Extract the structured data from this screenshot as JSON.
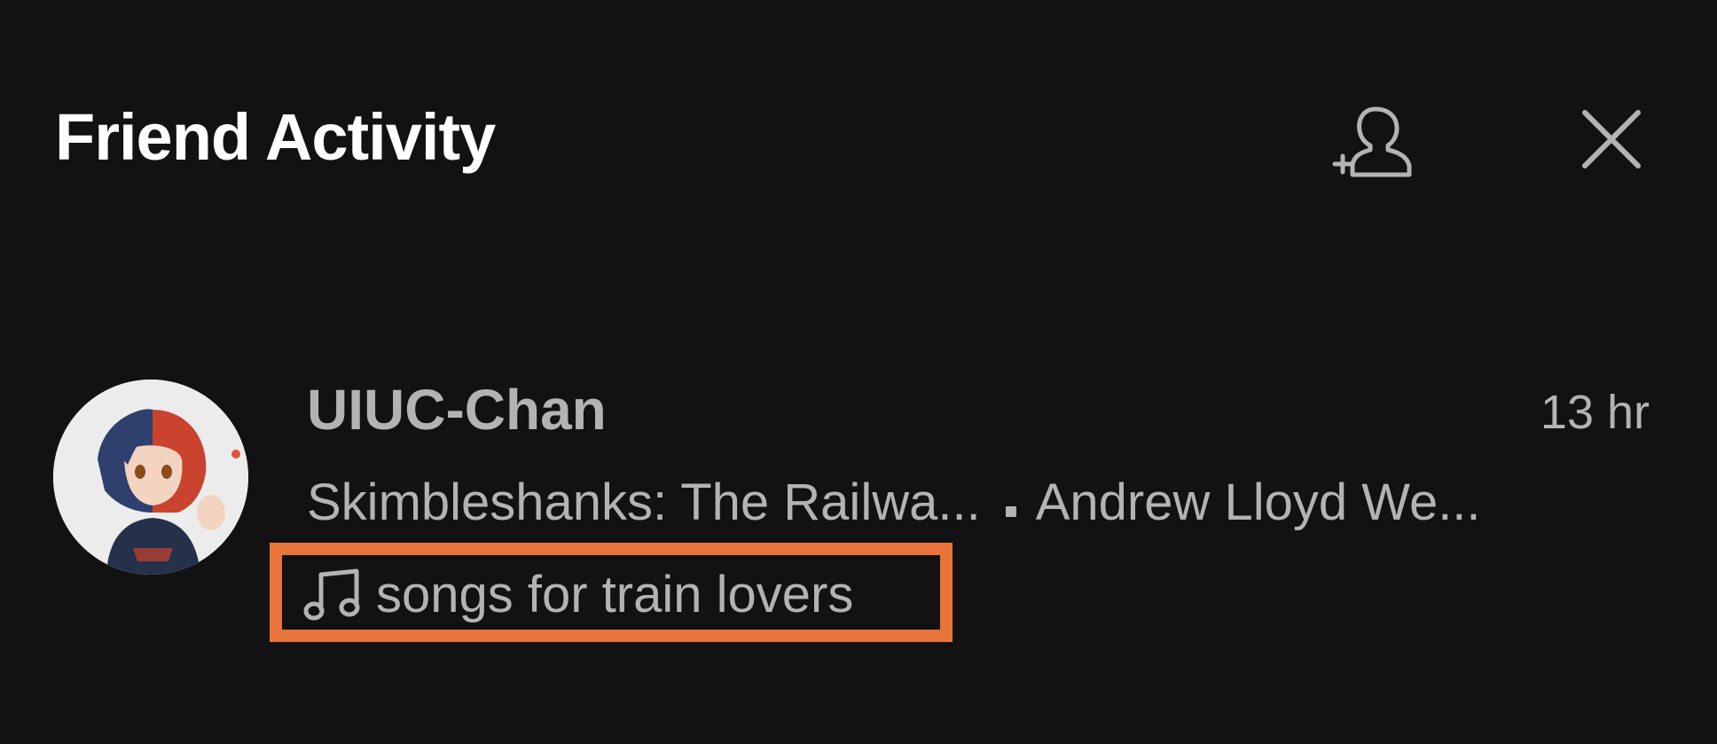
{
  "header": {
    "title": "Friend Activity",
    "add_friend_icon": "add-friend-icon",
    "close_icon": "close-icon"
  },
  "friends": [
    {
      "name": "UIUC-Chan",
      "time": "13 hr",
      "track": "Skimbleshanks: The Railwa...",
      "artist": "Andrew Lloyd We...",
      "playlist": "songs for train lovers",
      "playlist_icon": "music-note-icon",
      "avatar_icon": "avatar"
    }
  ],
  "colors": {
    "background": "#121212",
    "title": "#ffffff",
    "text_muted": "#b3b3b3",
    "highlight": "#e8743b"
  }
}
